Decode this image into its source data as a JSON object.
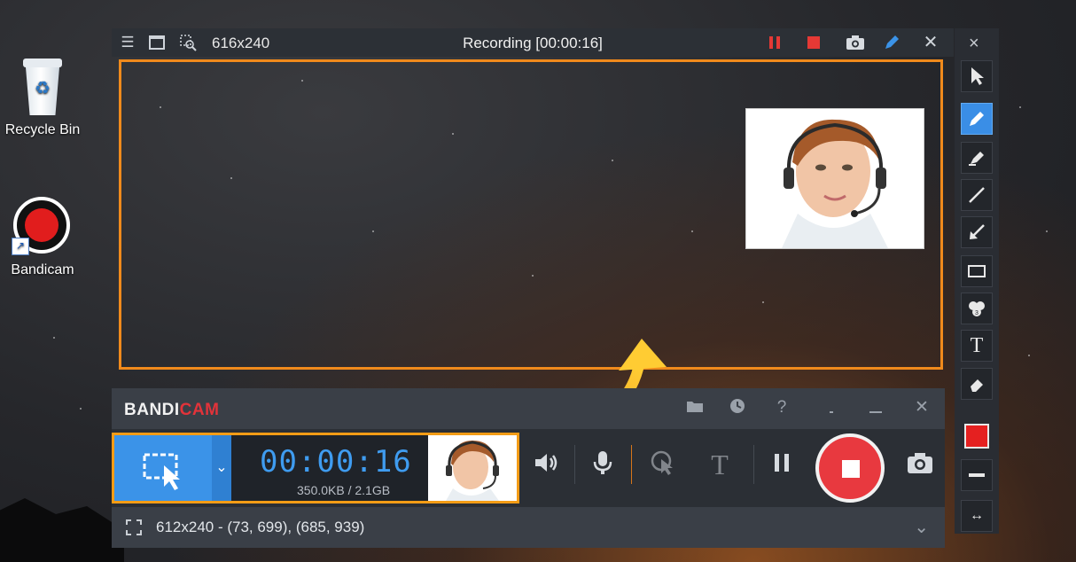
{
  "desktop": {
    "icons": [
      {
        "label": "Recycle Bin",
        "icon": "recycle-bin-icon"
      },
      {
        "label": "Bandicam",
        "icon": "bandicam-icon"
      }
    ]
  },
  "recording_window": {
    "size_label": "616x240",
    "status": "Recording [00:00:16]",
    "titlebar_icons": [
      "menu-icon",
      "window-icon",
      "search-window-icon"
    ],
    "controls": [
      "pause-icon",
      "stop-icon",
      "camera-icon",
      "pencil-icon",
      "close-icon"
    ],
    "colors": {
      "frame": "#f08a1c",
      "pause": "#e53935",
      "stop": "#e53935"
    }
  },
  "draw_tools": {
    "close": "×",
    "tools": [
      "cursor-icon",
      "pencil-icon",
      "highlighter-icon",
      "line-icon",
      "arrow-icon",
      "rectangle-icon",
      "numbering-icon",
      "text-icon",
      "eraser-icon"
    ],
    "text_tool_label": "T",
    "active_tool": "pencil-icon",
    "color": "#e52020",
    "resize_symbol": "↔"
  },
  "bandicam": {
    "logo_main": "BANDI",
    "logo_accent": "CAM",
    "header_icons": [
      "folder-icon",
      "clock-icon",
      "help-icon",
      "minimize-icon",
      "close-icon"
    ],
    "help_label": "?",
    "timer": "00:00:16",
    "file_size": "350.0KB / 2.1GB",
    "text_button": "T",
    "toolbar_icons": [
      "speaker-icon",
      "microphone-icon",
      "cursor-click-icon",
      "text-overlay-icon",
      "pause-icon",
      "stop-icon",
      "camera-icon"
    ],
    "status": "612x240 - (73, 699), (685, 939)",
    "colors": {
      "accent": "#3b93e8",
      "record": "#e8393f",
      "highlight": "#f39c16"
    }
  }
}
